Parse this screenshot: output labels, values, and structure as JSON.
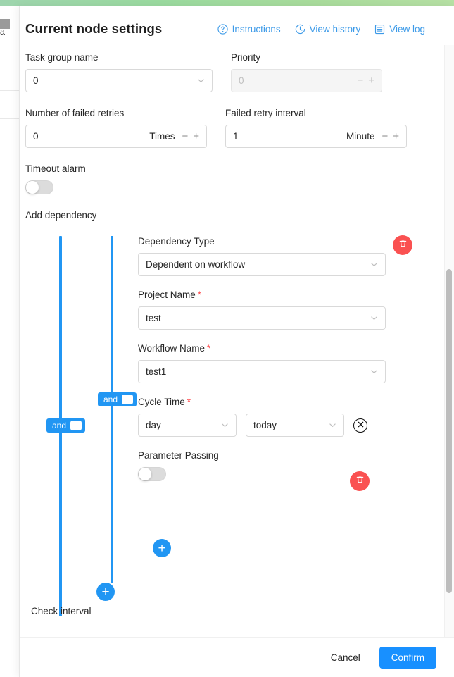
{
  "background": {
    "side_text": "a"
  },
  "modal": {
    "title": "Current node settings",
    "header_links": [
      {
        "label": "Instructions",
        "icon": "question-circle-icon"
      },
      {
        "label": "View history",
        "icon": "clock-history-icon"
      },
      {
        "label": "View log",
        "icon": "document-list-icon"
      }
    ],
    "fields": {
      "task_group_name": {
        "label": "Task group name",
        "value": "0"
      },
      "priority": {
        "label": "Priority",
        "value": "0",
        "disabled": true
      },
      "failed_retries": {
        "label": "Number of failed retries",
        "value": "0",
        "unit": "Times"
      },
      "failed_retry_interval": {
        "label": "Failed retry interval",
        "value": "1",
        "unit": "Minute"
      },
      "timeout_alarm": {
        "label": "Timeout alarm",
        "enabled": false
      }
    },
    "dependency": {
      "label": "Add dependency",
      "check_interval_label": "Check interval",
      "and_badges": [
        {
          "label": "and"
        },
        {
          "label": "and"
        }
      ],
      "form": {
        "dependency_type": {
          "label": "Dependency Type",
          "value": "Dependent on workflow",
          "required": false
        },
        "project_name": {
          "label": "Project Name",
          "value": "test",
          "required": true
        },
        "workflow_name": {
          "label": "Workflow Name",
          "value": "test1",
          "required": true
        },
        "cycle_time": {
          "label": "Cycle Time",
          "required": true,
          "cycle": "day",
          "date": "today"
        },
        "parameter_passing": {
          "label": "Parameter Passing",
          "enabled": false
        }
      }
    },
    "footer": {
      "cancel": "Cancel",
      "confirm": "Confirm"
    }
  },
  "colors": {
    "accent_blue": "#1890ff",
    "link_blue": "#3c9ae8",
    "line_blue": "#2196f3",
    "danger_red": "#fa5151",
    "required_red": "#ff4d4f",
    "topbar_green": "#9ada9f"
  }
}
